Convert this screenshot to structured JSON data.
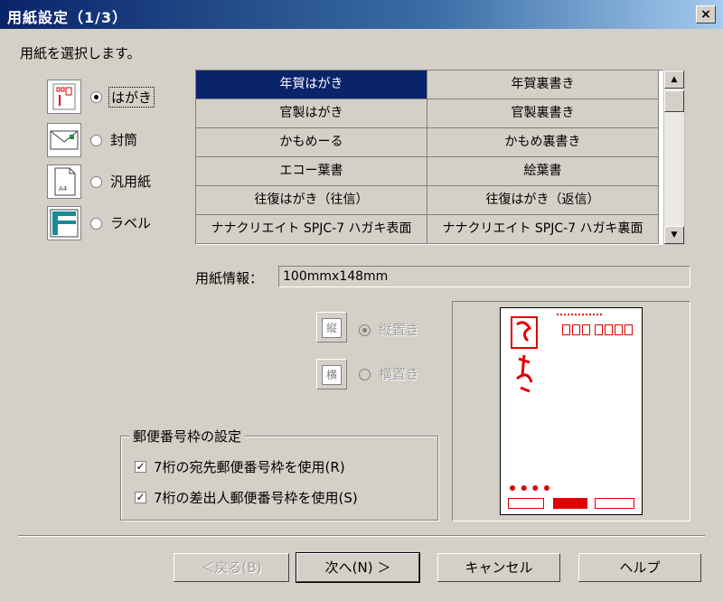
{
  "window": {
    "title": "用紙設定（1/3）",
    "close": "×"
  },
  "instruction": "用紙を選択します。",
  "paper_types": [
    {
      "label": "はがき",
      "icon": "postcard-icon",
      "selected": true
    },
    {
      "label": "封筒",
      "icon": "envelope-icon",
      "selected": false
    },
    {
      "label": "汎用紙",
      "icon": "plain-paper-icon",
      "selected": false
    },
    {
      "label": "ラベル",
      "icon": "label-icon",
      "selected": false
    }
  ],
  "paper_grid": [
    [
      "年賀はがき",
      "年賀裏書き"
    ],
    [
      "官製はがき",
      "官製裏書き"
    ],
    [
      "かもめーる",
      "かもめ裏書き"
    ],
    [
      "エコー葉書",
      "絵葉書"
    ],
    [
      "往復はがき（往信）",
      "往復はがき（返信）"
    ],
    [
      "ナナクリエイト SPJC-7 ハガキ表面",
      "ナナクリエイト SPJC-7 ハガキ裏面"
    ]
  ],
  "paper_info": {
    "label": "用紙情報：",
    "value": "100mmx148mm"
  },
  "orientation": [
    {
      "label": "縦置き",
      "icon_char": "縦",
      "selected": true
    },
    {
      "label": "横置き",
      "icon_char": "横",
      "selected": false
    }
  ],
  "postal_group": {
    "legend": "郵便番号枠の設定",
    "options": [
      {
        "label": "7桁の宛先郵便番号枠を使用(R)",
        "checked": true
      },
      {
        "label": "7桁の差出人郵便番号枠を使用(S)",
        "checked": true
      }
    ]
  },
  "buttons": {
    "back": "＜戻る(B)",
    "next": "次へ(N) ＞",
    "cancel": "キャンセル",
    "help": "ヘルプ"
  },
  "colors": {
    "title_start": "#0a246a",
    "selection": "#0a246a",
    "stamp_red": "#e00000",
    "face": "#d4d0c8"
  }
}
